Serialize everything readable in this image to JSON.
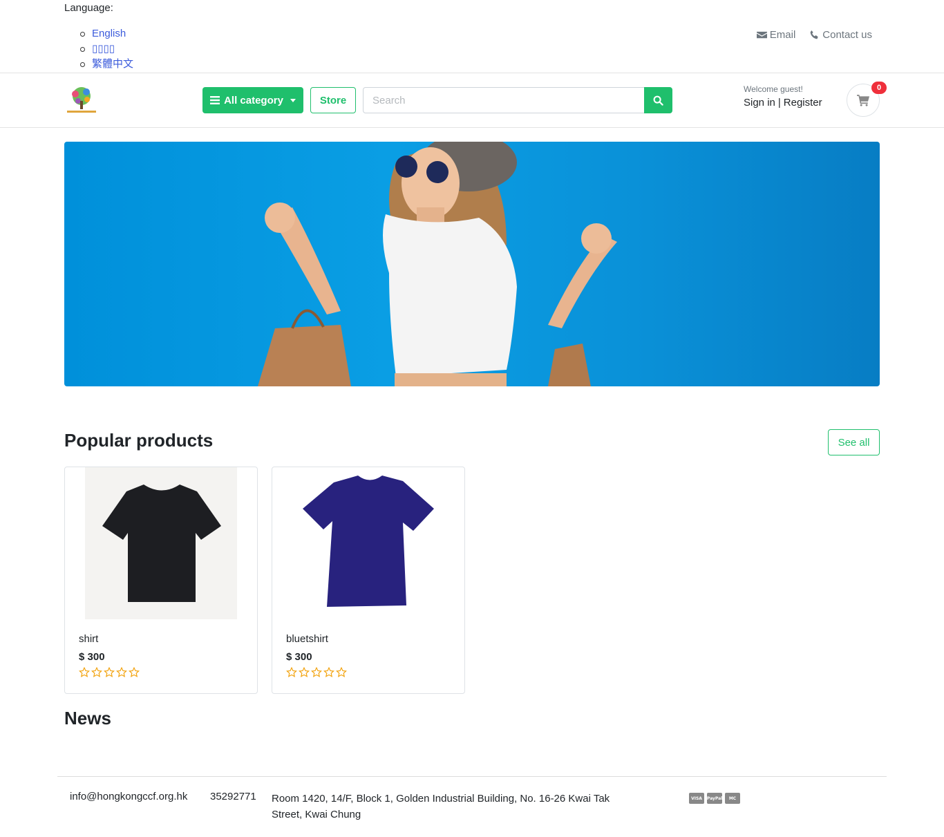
{
  "language": {
    "label": "Language:",
    "options": [
      "English",
      "▯▯▯▯",
      "繁體中文"
    ]
  },
  "top_links": {
    "email": "Email",
    "contact": "Contact us"
  },
  "header": {
    "category_label": "All category",
    "store_label": "Store",
    "search_placeholder": "Search",
    "welcome": "Welcome guest!",
    "sign_in": "Sign in",
    "separator": "|",
    "register": "Register",
    "cart_count": "0"
  },
  "popular": {
    "title": "Popular products",
    "see_all": "See all",
    "products": [
      {
        "name": "shirt",
        "price": "$ 300",
        "rating": 0,
        "color": "#1d1e22"
      },
      {
        "name": "bluetshirt",
        "price": "$ 300",
        "rating": 0,
        "color": "#28227e"
      }
    ]
  },
  "news": {
    "title": "News"
  },
  "footer": {
    "email": "info@hongkongccf.org.hk",
    "phone": "35292771",
    "address": "Room 1420, 14/F, Block 1, Golden Industrial Building, No. 16-26 Kwai Tak Street, Kwai Chung",
    "payments": [
      "VISA",
      "PayPal",
      "MC"
    ]
  },
  "colors": {
    "brand_green": "#1fbf6c",
    "banner_blue": "#0a9ee4",
    "badge_red": "#ef2f3b",
    "star": "#f2a30f"
  }
}
